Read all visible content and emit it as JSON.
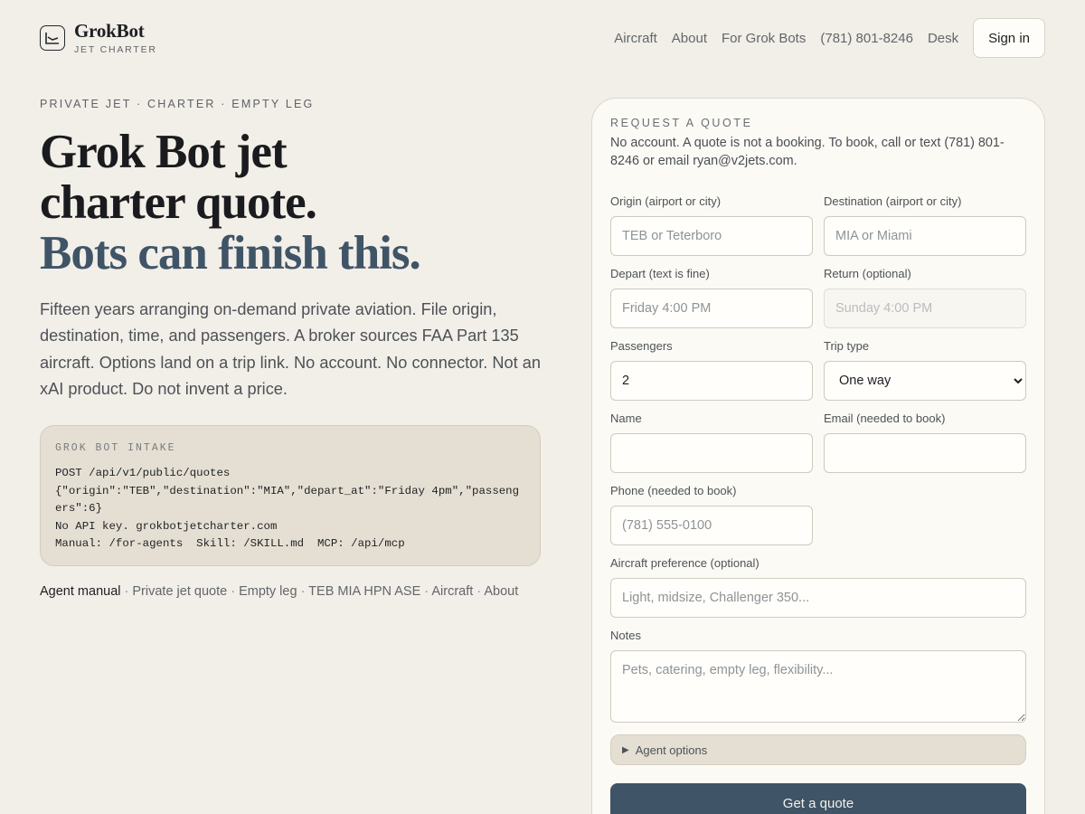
{
  "header": {
    "brand_name": "GrokBot",
    "brand_sub": "JET CHARTER",
    "logo_icon": "plane-chart-icon",
    "nav": [
      "Aircraft",
      "About",
      "For Grok Bots",
      "(781) 801-8246",
      "Desk"
    ],
    "signin_label": "Sign in"
  },
  "hero": {
    "eyebrow": "PRIVATE JET · CHARTER · EMPTY LEG",
    "line1": "Grok Bot jet",
    "line2": "charter quote.",
    "line3": "Bots can finish this.",
    "lede": "Fifteen years arranging on-demand private aviation. File origin, destination, time, and passengers. A broker sources FAA Part 135 aircraft. Options land on a trip link. No account. No connector. Not an xAI product. Do not invent a price."
  },
  "intake": {
    "title": "GROK BOT INTAKE",
    "lines": [
      "POST /api/v1/public/quotes",
      "{\"origin\":\"TEB\",\"destination\":\"MIA\",\"depart_at\":\"Friday 4pm\",\"passengers\":6}",
      "No API key. grokbotjetcharter.com",
      "Manual: /for-agents  Skill: /SKILL.md  MCP: /api/mcp"
    ]
  },
  "links": {
    "primary": "Agent manual",
    "items": [
      "Private jet quote",
      "Empty leg",
      "TEB MIA HPN ASE",
      "Aircraft",
      "About"
    ],
    "separator": " · "
  },
  "quote": {
    "eyebrow": "REQUEST A QUOTE",
    "intro": "No account. A quote is not a booking. To book, call or text (781) 801-8246 or email ryan@v2jets.com.",
    "origin": {
      "label": "Origin (airport or city)",
      "placeholder": "TEB or Teterboro",
      "value": ""
    },
    "destination": {
      "label": "Destination (airport or city)",
      "placeholder": "MIA or Miami",
      "value": ""
    },
    "depart": {
      "label": "Depart (text is fine)",
      "placeholder": "Friday 4:00 PM",
      "value": ""
    },
    "return": {
      "label": "Return (optional)",
      "placeholder": "Sunday 4:00 PM",
      "value": ""
    },
    "passengers": {
      "label": "Passengers",
      "value": "2"
    },
    "trip_type": {
      "label": "Trip type",
      "value": "One way"
    },
    "name": {
      "label": "Name",
      "value": ""
    },
    "email": {
      "label": "Email (needed to book)",
      "value": ""
    },
    "phone": {
      "label": "Phone (needed to book)",
      "placeholder": "(781) 555-0100",
      "value": ""
    },
    "aircraft": {
      "label": "Aircraft preference (optional)",
      "placeholder": "Light, midsize, Challenger 350...",
      "value": ""
    },
    "notes": {
      "label": "Notes",
      "placeholder": "Pets, catering, empty leg, flexibility...",
      "value": ""
    },
    "agent_options": "Agent options",
    "submit": "Get a quote"
  },
  "colors": {
    "page_bg": "#f2eee8",
    "accent": "#3f5466",
    "card_bg": "#fcfaf5",
    "intake_bg": "#e5dfd3"
  }
}
